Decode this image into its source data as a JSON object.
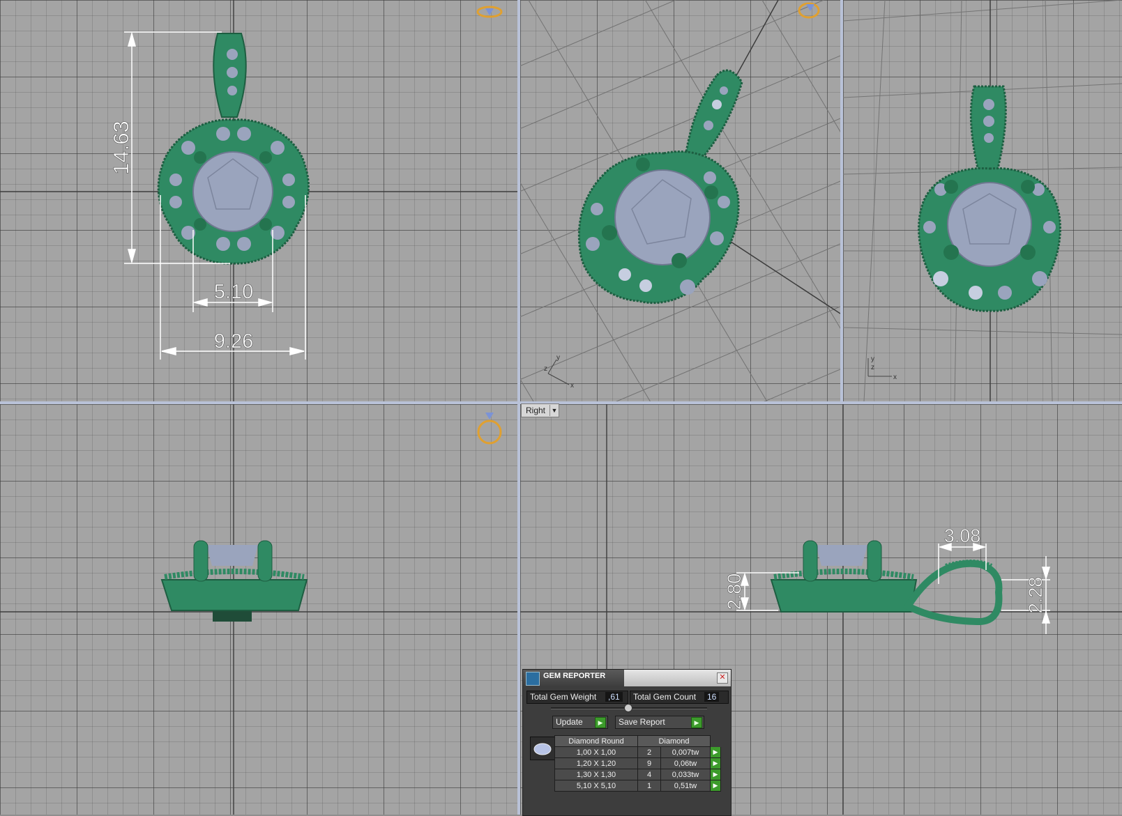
{
  "colors": {
    "metal": "#2f8a63",
    "metal_dark": "#1d5e41",
    "gem": "#9aa4bd",
    "dimension": "#ffffff",
    "gizmo": "#e0a030"
  },
  "dimensions": {
    "height": "14.63",
    "center_gem": "5.10",
    "width": "9.26",
    "bail_width": "3.08",
    "setting_height": "2.80",
    "bail_height": "2.28"
  },
  "axes": {
    "x": "x",
    "y": "y",
    "z": "z"
  },
  "view_selector": {
    "value": "Right"
  },
  "gem_reporter": {
    "title": "GEM REPORTER",
    "total_weight_label": "Total Gem Weight",
    "total_weight_value": ",61",
    "total_count_label": "Total Gem Count",
    "total_count_value": "16",
    "update_label": "Update",
    "save_label": "Save Report",
    "table": {
      "header_shape": "Diamond Round",
      "header_type": "Diamond",
      "rows": [
        {
          "size": "1,00 X 1,00",
          "count": "2",
          "weight": "0,007tw"
        },
        {
          "size": "1,20 X 1,20",
          "count": "9",
          "weight": "0,06tw"
        },
        {
          "size": "1,30 X 1,30",
          "count": "4",
          "weight": "0,033tw"
        },
        {
          "size": "5,10 X 5,10",
          "count": "1",
          "weight": "0,51tw"
        }
      ]
    }
  }
}
